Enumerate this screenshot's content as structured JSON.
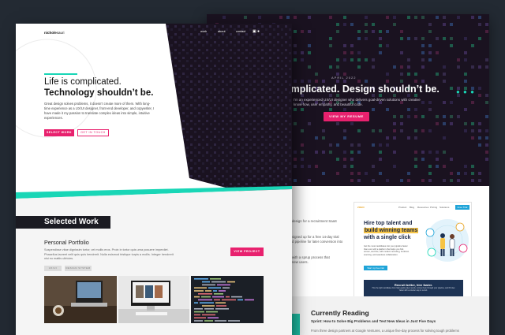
{
  "front": {
    "logo_bold": "nichole",
    "logo_light": "sauri",
    "nav": [
      "work",
      "about",
      "contact"
    ],
    "hero": {
      "line1": "Life is complicated.",
      "line2": "Technology shouldn’t be.",
      "body": "Great design solves problems, it doesn’t create more of them. With long-time experience as a UX/UI designer, front-end developer, and copywriter, I have made it my passion to translate complex ideas into simple, intuitive experiences.",
      "btn_select_work": "SELECT WORK",
      "btn_get_in_touch": "GET IN TOUCH"
    },
    "selected_work": {
      "title": "Selected Work",
      "project_title": "Personal Portfolio",
      "project_desc": "Suspendisse vitae dignissim tortor, vel mollis eros. Proin in tortor quis urna posuere imperdiet. Phasellus laoreet velit quis quis hendrerit. Nulla euismod tristique turpis a mollis. Integer hendrerit nisi eu mattis ultricies.",
      "view_project": "VIEW PROJECT",
      "tags": [
        "UX/UI",
        "DESIGN SYSTEM"
      ]
    }
  },
  "back": {
    "date": "APRIL 2022",
    "tagline": "complicated. Design shouldn’t be.",
    "sub": "I'm an experienced UX/UI designer who delivers goal-driven solutions with creative know-how, user empathy, and beautiful code.",
    "resume": "VIEW MY RESUME",
    "mid_lines": [
      "design for a recruitment SaaS",
      "",
      "signed up for a free 14-day trial",
      "d pipeline for later conversion into",
      "",
      "with a sprup process that",
      "new users."
    ],
    "project": {
      "logo": "ZOHO",
      "nav": [
        "Product",
        "Blog",
        "Resources",
        "Pricing",
        "Solutions"
      ],
      "cta": "Free Trial",
      "headline_1": "Hire top talent and",
      "headline_2": "build winning teams",
      "headline_3": "with a single click",
      "sub": "Get the most candidates into your pipeline faster than ever with a platform that helps you find, screen, and hire, with modern recruiting, AI-driven sourcing, and seamless collaboration.",
      "btn": "Start my free trial",
      "band_title": "Recruit better, hire faster.",
      "band_sub": "Hire the right candidates from high-quality talent pools, nurture them through your pipeline, and fill roles faster with a smarter way to recruit."
    },
    "reading": {
      "title": "Currently Reading",
      "book": "Sprint: How to Solve Big Problems and Test New Ideas in Just Five Days",
      "desc": "From three design partners at Google Ventures, a unique five-day process for solving tough problems"
    }
  },
  "colors": {
    "accent_teal": "#19d6b6",
    "accent_pink": "#e8216e",
    "dark": "#1a1220",
    "backdrop": "#232a33"
  }
}
